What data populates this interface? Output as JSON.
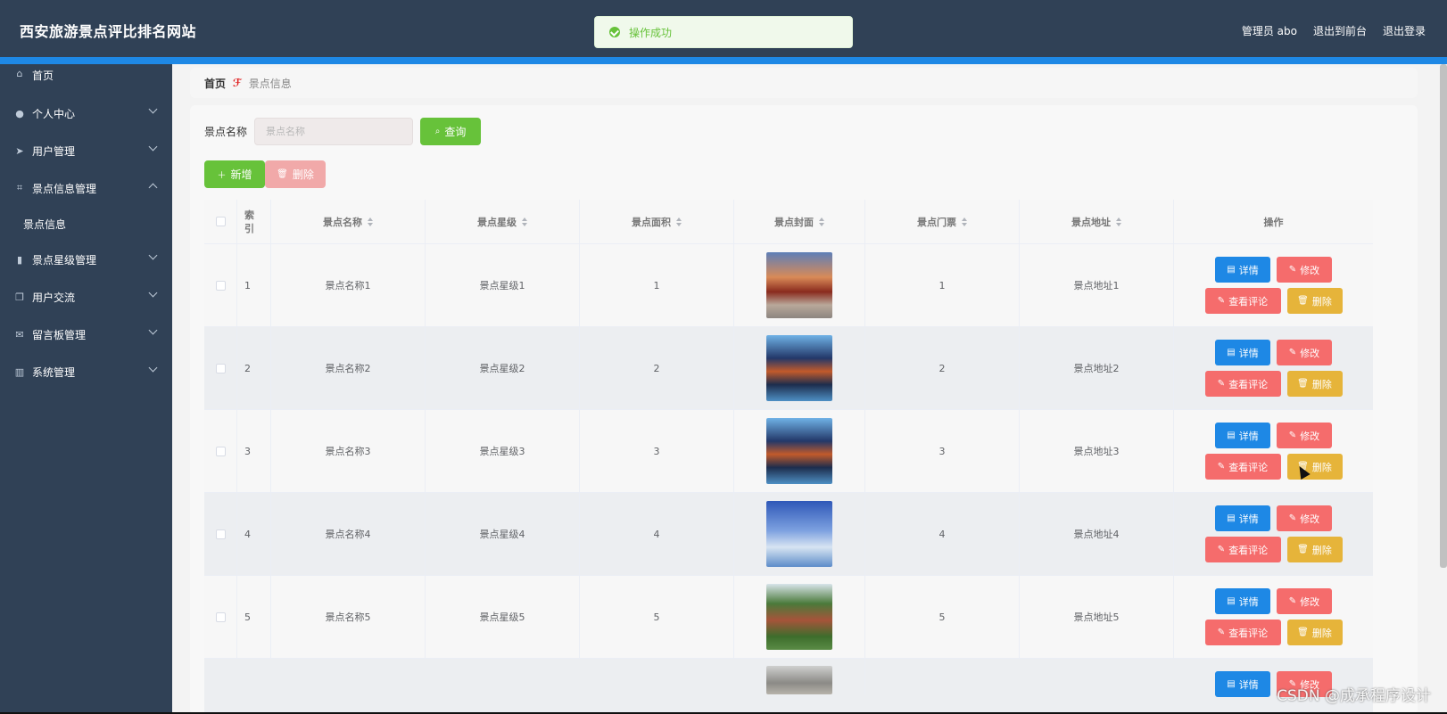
{
  "header": {
    "brand": "西安旅游景点评比排名网站",
    "user_label": "管理员 abo",
    "to_front": "退出到前台",
    "logout": "退出登录"
  },
  "toast": {
    "message": "操作成功"
  },
  "sidebar": {
    "items": [
      {
        "label": "首页",
        "icon": "home-icon"
      },
      {
        "label": "个人中心",
        "icon": "user-icon"
      },
      {
        "label": "用户管理",
        "icon": "send-icon"
      },
      {
        "label": "景点信息管理",
        "icon": "crop-icon",
        "expanded": true
      },
      {
        "label": "景点信息",
        "sub": true
      },
      {
        "label": "景点星级管理",
        "icon": "mic-icon"
      },
      {
        "label": "用户交流",
        "icon": "copy-icon"
      },
      {
        "label": "留言板管理",
        "icon": "message-icon"
      },
      {
        "label": "系统管理",
        "icon": "chart-icon"
      }
    ]
  },
  "breadcrumb": {
    "home": "首页",
    "current": "景点信息"
  },
  "search": {
    "label": "景点名称",
    "placeholder": "景点名称",
    "query_label": "查询"
  },
  "toolbar": {
    "add_label": "新增",
    "delete_label": "删除"
  },
  "table": {
    "headers": [
      "索引",
      "景点名称",
      "景点星级",
      "景点面积",
      "景点封面",
      "景点门票",
      "景点地址",
      "操作"
    ],
    "rows": [
      {
        "index": "1",
        "name": "景点名称1",
        "star": "景点星级1",
        "area": "1",
        "ticket": "1",
        "address": "景点地址1"
      },
      {
        "index": "2",
        "name": "景点名称2",
        "star": "景点星级2",
        "area": "2",
        "ticket": "2",
        "address": "景点地址2"
      },
      {
        "index": "3",
        "name": "景点名称3",
        "star": "景点星级3",
        "area": "3",
        "ticket": "3",
        "address": "景点地址3"
      },
      {
        "index": "4",
        "name": "景点名称4",
        "star": "景点星级4",
        "area": "4",
        "ticket": "4",
        "address": "景点地址4"
      },
      {
        "index": "5",
        "name": "景点名称5",
        "star": "景点星级5",
        "area": "5",
        "ticket": "5",
        "address": "景点地址5"
      }
    ],
    "actions": {
      "detail": "详情",
      "edit": "修改",
      "review": "查看评论",
      "delete": "删除"
    }
  },
  "watermark": "CSDN @成承程序设计",
  "colors": {
    "sidebar": "#304156",
    "accent": "#1e88e5",
    "success": "#67c23a",
    "danger": "#f56c6c",
    "warning": "#e6b43a"
  }
}
